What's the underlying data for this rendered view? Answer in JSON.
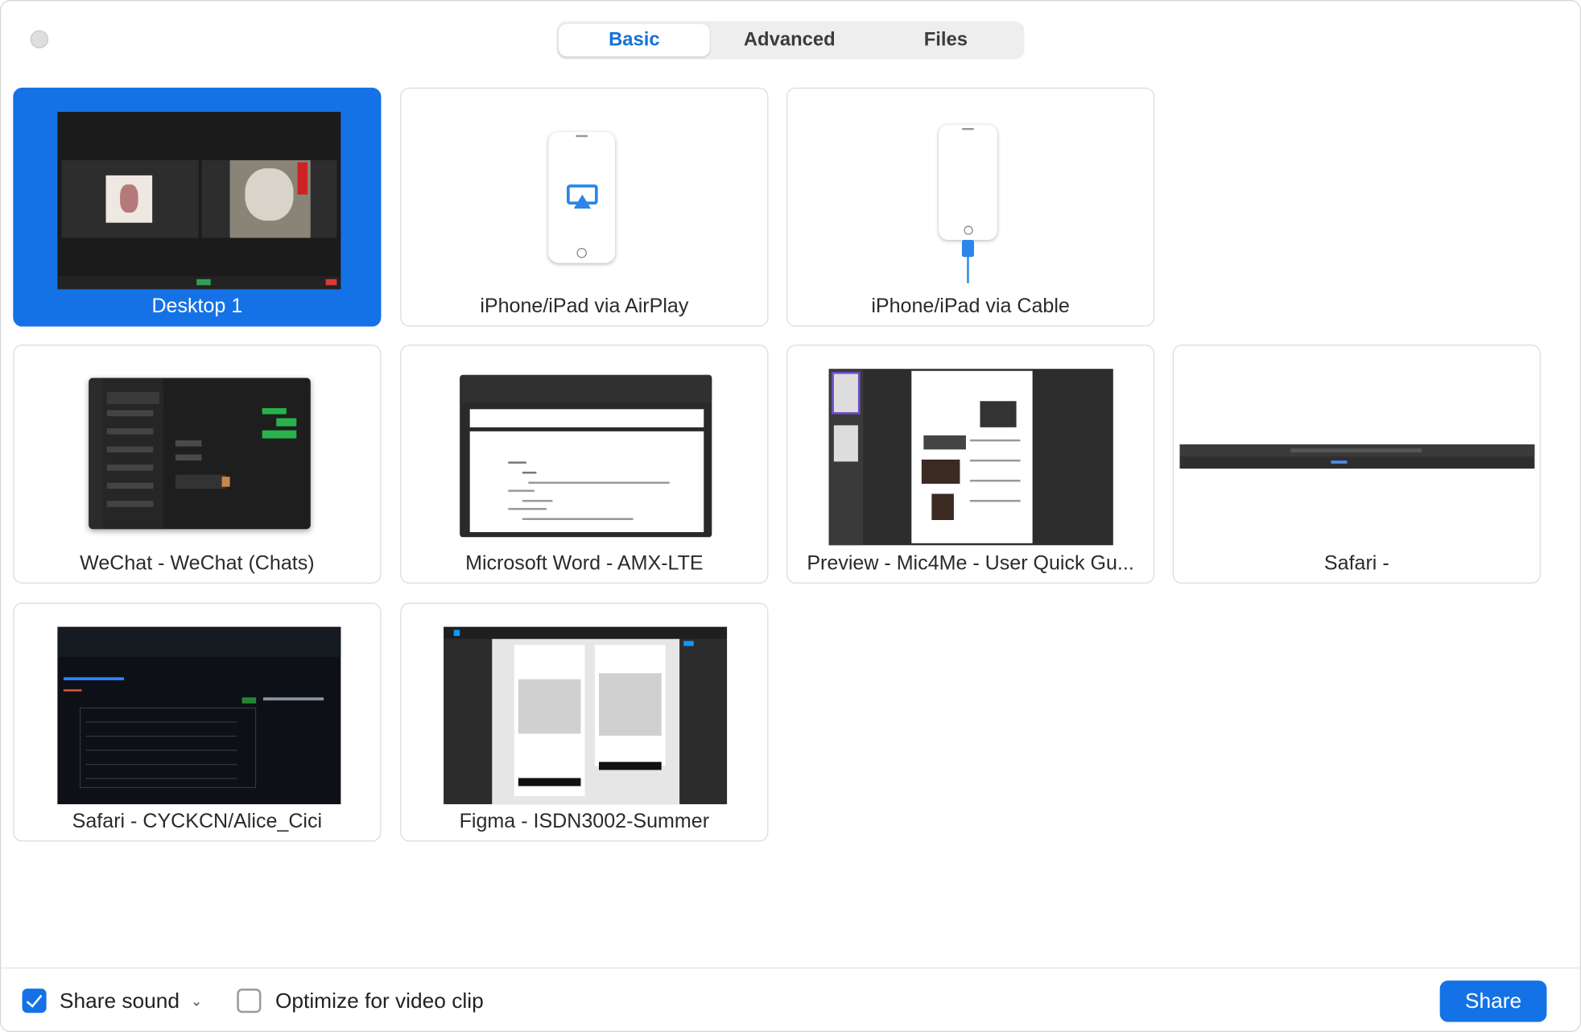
{
  "tabs": [
    {
      "label": "Basic",
      "active": true
    },
    {
      "label": "Advanced",
      "active": false
    },
    {
      "label": "Files",
      "active": false
    }
  ],
  "tiles": [
    {
      "label": "Desktop 1",
      "selected": true
    },
    {
      "label": "iPhone/iPad via AirPlay",
      "selected": false
    },
    {
      "label": "iPhone/iPad via Cable",
      "selected": false
    },
    {
      "label": "WeChat - WeChat (Chats)",
      "selected": false
    },
    {
      "label": "Microsoft Word - AMX-LTE",
      "selected": false
    },
    {
      "label": "Preview - Mic4Me - User Quick Gu...",
      "selected": false
    },
    {
      "label": "Safari -",
      "selected": false
    },
    {
      "label": "Safari - CYCKCN/Alice_Cici",
      "selected": false
    },
    {
      "label": "Figma - ISDN3002-Summer",
      "selected": false
    }
  ],
  "footer": {
    "share_sound": {
      "label": "Share sound",
      "checked": true
    },
    "optimize": {
      "label": "Optimize for video clip",
      "checked": false
    },
    "share_button": "Share"
  },
  "colors": {
    "accent": "#1472e6",
    "tab_active_text": "#1472d9"
  }
}
